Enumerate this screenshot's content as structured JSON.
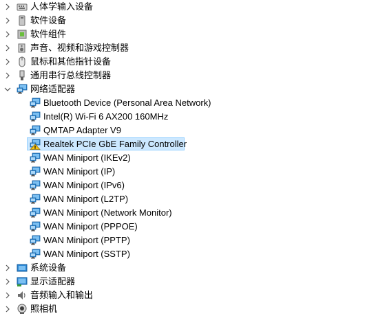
{
  "device_tree": {
    "categories_top": [
      {
        "label": "人体学输入设备",
        "expanded": false,
        "icon": "hid-icon"
      },
      {
        "label": "软件设备",
        "expanded": false,
        "icon": "software-device-icon"
      },
      {
        "label": "软件组件",
        "expanded": false,
        "icon": "software-component-icon"
      },
      {
        "label": "声音、视频和游戏控制器",
        "expanded": false,
        "icon": "speaker-icon"
      },
      {
        "label": "鼠标和其他指针设备",
        "expanded": false,
        "icon": "mouse-icon"
      },
      {
        "label": "通用串行总线控制器",
        "expanded": false,
        "icon": "usb-icon"
      }
    ],
    "network": {
      "label": "网络适配器",
      "expanded": true,
      "icon": "network-adapter-icon",
      "children": [
        {
          "label": "Bluetooth Device (Personal Area Network)",
          "warning": false
        },
        {
          "label": "Intel(R) Wi-Fi 6 AX200 160MHz",
          "warning": false
        },
        {
          "label": "QMTAP Adapter V9",
          "warning": false
        },
        {
          "label": "Realtek PCIe GbE Family Controller",
          "warning": true,
          "selected": true
        },
        {
          "label": "WAN Miniport (IKEv2)",
          "warning": false
        },
        {
          "label": "WAN Miniport (IP)",
          "warning": false
        },
        {
          "label": "WAN Miniport (IPv6)",
          "warning": false
        },
        {
          "label": "WAN Miniport (L2TP)",
          "warning": false
        },
        {
          "label": "WAN Miniport (Network Monitor)",
          "warning": false
        },
        {
          "label": "WAN Miniport (PPPOE)",
          "warning": false
        },
        {
          "label": "WAN Miniport (PPTP)",
          "warning": false
        },
        {
          "label": "WAN Miniport (SSTP)",
          "warning": false
        }
      ]
    },
    "categories_bottom": [
      {
        "label": "系统设备",
        "expanded": false,
        "icon": "system-device-icon"
      },
      {
        "label": "显示适配器",
        "expanded": false,
        "icon": "display-adapter-icon"
      },
      {
        "label": "音频输入和输出",
        "expanded": false,
        "icon": "audio-io-icon"
      },
      {
        "label": "照相机",
        "expanded": false,
        "icon": "camera-icon"
      }
    ]
  },
  "colors": {
    "selection_bg": "#cce8ff",
    "selection_border": "#99d1ff",
    "chevron": "#555555",
    "adapter_monitor": "#2d89d6",
    "warning": "#f5c211"
  }
}
